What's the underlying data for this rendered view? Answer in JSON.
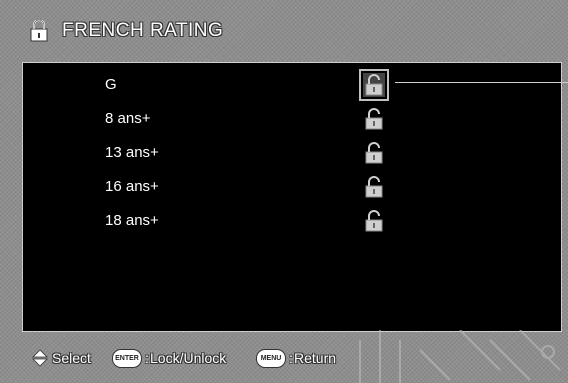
{
  "header": {
    "title": "FRENCH RATING",
    "icon": "lock-icon"
  },
  "ratings": [
    {
      "label": "G",
      "icon": "unlocked-padlock-icon",
      "selected": true
    },
    {
      "label": "8 ans+",
      "icon": "unlocked-padlock-icon",
      "selected": false
    },
    {
      "label": "13 ans+",
      "icon": "unlocked-padlock-icon",
      "selected": false
    },
    {
      "label": "16 ans+",
      "icon": "unlocked-padlock-icon",
      "selected": false
    },
    {
      "label": "18 ans+",
      "icon": "unlocked-padlock-icon",
      "selected": false
    }
  ],
  "footer": {
    "select_label": "Select",
    "enter_key": "ENTER",
    "lock_label": "Lock/Unlock",
    "menu_key": "MENU",
    "return_label": "Return",
    "separator": ":"
  },
  "colors": {
    "background": "#8e8e8e",
    "panel": "#000000",
    "text": "#ffffff"
  }
}
